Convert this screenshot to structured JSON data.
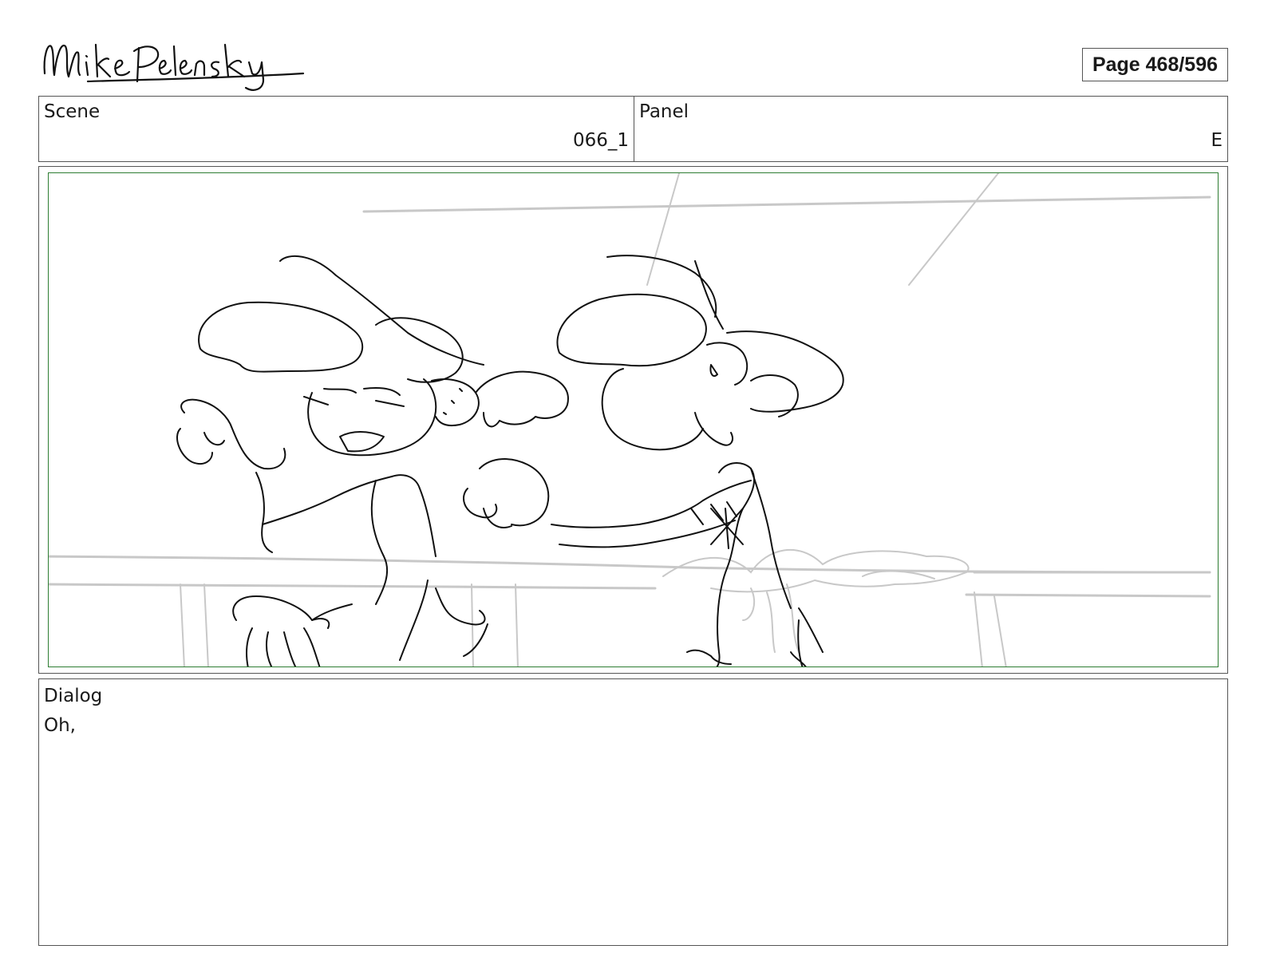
{
  "header": {
    "signature_text": "Mike Pelensky",
    "page_label": "Page 468/596"
  },
  "info": {
    "scene_label": "Scene",
    "scene_value": "066_1",
    "panel_label": "Panel",
    "panel_value": "E"
  },
  "dialog": {
    "label": "Dialog",
    "text": "Oh,"
  },
  "colors": {
    "frame_border": "#2e7d32",
    "sketch_line": "#111111",
    "guide_line": "#c8c8c8"
  }
}
